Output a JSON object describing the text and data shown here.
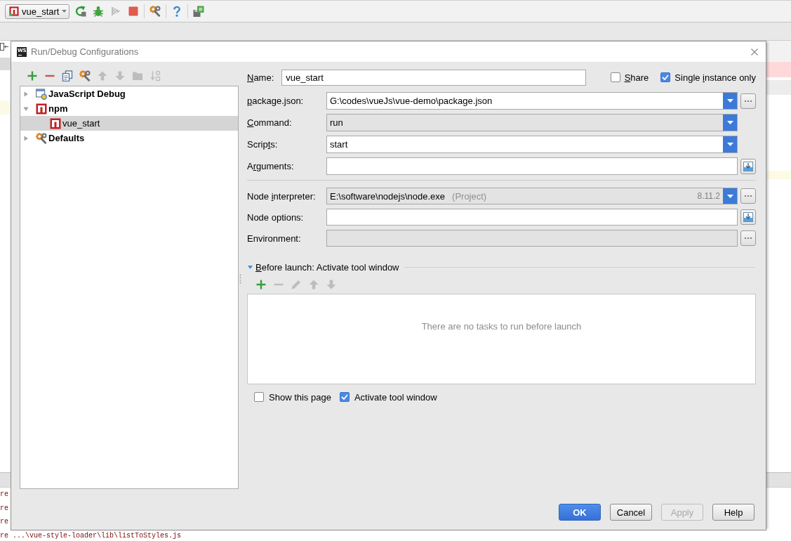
{
  "toolbar": {
    "run_config": {
      "kind": "npm",
      "label": "vue_start"
    },
    "groups": [
      [
        {
          "kind": "rerun",
          "disabled": false
        },
        {
          "kind": "debug",
          "disabled": false
        },
        {
          "kind": "coverage",
          "disabled": true
        },
        {
          "kind": "stop",
          "disabled": false
        }
      ],
      [
        {
          "kind": "configure",
          "disabled": false
        }
      ],
      [
        {
          "kind": "help",
          "disabled": false
        }
      ],
      [
        {
          "kind": "plugin",
          "disabled": false
        }
      ]
    ]
  },
  "console": {
    "lines": [
      "re",
      "re",
      "re",
      "re ...\\vue-style-loader\\lib\\listToStyles.js"
    ]
  },
  "dialog": {
    "app_logo": "WS",
    "title": "Run/Debug Configurations",
    "tree_toolbar": [
      {
        "kind": "add",
        "disabled": false
      },
      {
        "kind": "remove",
        "disabled": false
      },
      {
        "kind": "copy",
        "disabled": false
      },
      {
        "kind": "defaults",
        "disabled": false
      },
      {
        "kind": "up",
        "disabled": true
      },
      {
        "kind": "down",
        "disabled": true
      },
      {
        "kind": "folder",
        "disabled": true
      },
      {
        "kind": "sort",
        "disabled": true
      }
    ],
    "tree": [
      {
        "kind": "javascript",
        "label": "JavaScript Debug",
        "expanded": false,
        "selected": false
      },
      {
        "kind": "npm",
        "label": "npm",
        "expanded": true,
        "selected": false,
        "children": [
          {
            "kind": "npm",
            "label": "vue_start",
            "selected": true
          }
        ]
      },
      {
        "kind": "defaults",
        "label": "Defaults",
        "expanded": false,
        "selected": false
      }
    ],
    "name_field": {
      "label_runs": [
        {
          "text": "N",
          "underlined": true
        },
        {
          "text": "ame:",
          "underlined": false
        }
      ],
      "value": "vue_start"
    },
    "header_checkboxes": [
      {
        "label_runs": [
          {
            "text": "S",
            "underlined": true
          },
          {
            "text": "hare",
            "underlined": false
          }
        ],
        "checked": false
      },
      {
        "label_runs": [
          {
            "text": "Single ",
            "underlined": false
          },
          {
            "text": "i",
            "underlined": true
          },
          {
            "text": "nstance only",
            "underlined": false
          }
        ],
        "checked": true
      }
    ],
    "field_groups": [
      {
        "fields": [
          {
            "kind": "combo",
            "label_runs": [
              {
                "text": "p",
                "underlined": true
              },
              {
                "text": "ackage.json:",
                "underlined": false
              }
            ],
            "value": "G:\\codes\\vueJs\\vue-demo\\package.json",
            "editable": true,
            "side_button": {
              "kind": "browse"
            }
          },
          {
            "kind": "combo",
            "label_runs": [
              {
                "text": "C",
                "underlined": true
              },
              {
                "text": "ommand:",
                "underlined": false
              }
            ],
            "value": "run",
            "editable": false
          },
          {
            "kind": "combo",
            "label_runs": [
              {
                "text": "Scrip",
                "underlined": false
              },
              {
                "text": "t",
                "underlined": true
              },
              {
                "text": "s:",
                "underlined": false
              }
            ],
            "value": "start",
            "editable": true
          },
          {
            "kind": "text",
            "label_runs": [
              {
                "text": "A",
                "underlined": false
              },
              {
                "text": "r",
                "underlined": true
              },
              {
                "text": "guments:",
                "underlined": false
              }
            ],
            "editable": true,
            "side_button": {
              "kind": "expand"
            }
          }
        ]
      },
      {
        "fields": [
          {
            "kind": "combo",
            "label_runs": [
              {
                "text": "Node ",
                "underlined": false
              },
              {
                "text": "i",
                "underlined": true
              },
              {
                "text": "nterpreter:",
                "underlined": false
              }
            ],
            "value": "E:\\software\\nodejs\\node.exe",
            "hint": "(Project)",
            "version": "8.11.2",
            "editable": false,
            "side_button": {
              "kind": "browse"
            }
          },
          {
            "kind": "text",
            "label_runs": [
              {
                "text": "Node options:",
                "underlined": false
              }
            ],
            "editable": true,
            "side_button": {
              "kind": "expand"
            }
          },
          {
            "kind": "text",
            "label_runs": [
              {
                "text": "Environment:",
                "underlined": false
              }
            ],
            "editable": false,
            "side_button": {
              "kind": "browse"
            }
          }
        ]
      }
    ],
    "before_launch": {
      "label_runs": [
        {
          "text": "B",
          "underlined": true
        },
        {
          "text": "efore launch: Activate tool window",
          "underlined": false
        }
      ],
      "expanded": true,
      "toolbar": [
        {
          "kind": "add",
          "disabled": false
        },
        {
          "kind": "remove",
          "disabled": true
        },
        {
          "kind": "edit",
          "disabled": true
        },
        {
          "kind": "up",
          "disabled": true
        },
        {
          "kind": "down",
          "disabled": true
        }
      ],
      "empty_text": "There are no tasks to run before launch"
    },
    "options": [
      {
        "label": "Show this page",
        "checked": false
      },
      {
        "label": "Activate tool window",
        "checked": true
      }
    ],
    "buttons": [
      {
        "kind": "default",
        "label": "OK",
        "disabled": false
      },
      {
        "kind": "normal",
        "label": "Cancel",
        "disabled": false
      },
      {
        "kind": "normal",
        "label": "Apply",
        "disabled": true
      },
      {
        "kind": "normal",
        "label": "Help",
        "disabled": false
      }
    ]
  }
}
